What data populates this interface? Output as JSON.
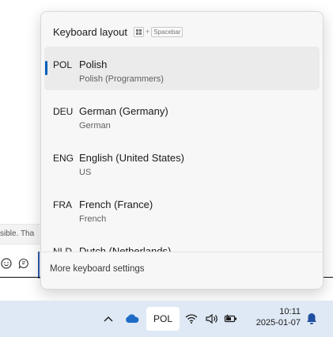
{
  "flyout": {
    "title": "Keyboard layout",
    "shortcut_plus": "+",
    "shortcut_key": "Spacebar",
    "languages": [
      {
        "code": "POL",
        "name": "Polish",
        "layout": "Polish (Programmers)",
        "selected": true
      },
      {
        "code": "DEU",
        "name": "German (Germany)",
        "layout": "German",
        "selected": false
      },
      {
        "code": "ENG",
        "name": "English (United States)",
        "layout": "US",
        "selected": false
      },
      {
        "code": "FRA",
        "name": "French (France)",
        "layout": "French",
        "selected": false
      },
      {
        "code": "NLD",
        "name": "Dutch (Netherlands)",
        "layout": "",
        "selected": false
      }
    ],
    "more_settings": "More keyboard settings"
  },
  "background": {
    "strip_text": "sible. Tha"
  },
  "taskbar": {
    "language": "POL",
    "time": "10:11",
    "date": "2025-01-07"
  },
  "colors": {
    "accent": "#005fb8",
    "taskbar_bg": "#dfe9f5",
    "flyout_bg": "#f7f7f7",
    "cloud": "#1e6bc6",
    "bell": "#1f4fa0"
  }
}
